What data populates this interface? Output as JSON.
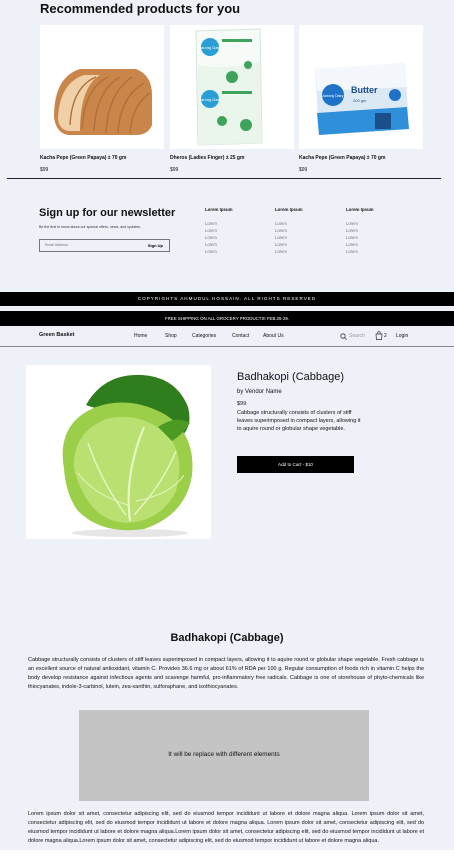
{
  "recommended": {
    "title": "Recommended products for you",
    "products": [
      {
        "name": "Kacha Pepe (Green Papaya) ± 70 gm",
        "price": "$99"
      },
      {
        "name": "Dheros (Ladies Finger) ± 25 gm",
        "price": "$99"
      },
      {
        "name": "Kacha Pepe (Green Papaya) ± 70 gm",
        "price": "$99"
      }
    ]
  },
  "newsletter": {
    "title": "Sign up for our newsletter",
    "subtitle": "Be the first to know about our special offers, news, and updates.",
    "email_placeholder": "Email Address",
    "submit_label": "Sign Up"
  },
  "footer_columns": [
    {
      "heading": "Lorem Ipsum",
      "links": [
        "Lorem",
        "Lorem",
        "Lorem",
        "Lorem",
        "Lorem"
      ]
    },
    {
      "heading": "Lorem Ipsum",
      "links": [
        "Lorem",
        "Lorem",
        "Lorem",
        "Lorem",
        "Lorem"
      ]
    },
    {
      "heading": "Lorem Ipsum",
      "links": [
        "Lorem",
        "Lorem",
        "Lorem",
        "Lorem",
        "Lorem"
      ]
    }
  ],
  "copyright": "COPYRIGHTS AHMUDUL HOSSAIN. ALL RIGHTS RESERVED",
  "shipping_banner": "FREE SHIPPING ON ALL GROCERY PRODUCTS! FEB.25-29.",
  "nav": {
    "brand": "Green Basket",
    "links": [
      "Home",
      "Shop",
      "Categories",
      "Contact",
      "About Us"
    ],
    "search_placeholder": "Search",
    "cart_count": "2",
    "login": "Login"
  },
  "product": {
    "title": "Badhakopi (Cabbage)",
    "vendor": "by Vendor Name",
    "price": "$99",
    "short_description": "Cabbage structurally consists of clusters of stiff leaves superimposed in compact layers, allowing it to aquire round or globular shape vegetable.",
    "add_to_cart": "Add to Cart - $10"
  },
  "details": {
    "title": "Badhakopi (Cabbage)",
    "description": "Cabbage structurally consists of clusters of stiff leaves superimposed in compact layers, allowing it to aquire round or globular shape vegetable. Fresh cabbage is an excellent source of natural antioxidant, vitamin C. Provides 36.6 mg or about 61% of RDA per 100 g. Regular consumption of foods rich in vitamin C helps the body develop resistance against infectious agents and scavenge harmful, pro-inflammatory free radicals. Cabbage is one of storehouse of phyto-chemicals like thiocyanates, indole-3-carbinol, lutein, zea-xanthin, sulforaphane, and isothiocyanates.",
    "placeholder_text": "It will be replace with different elements",
    "lorem": "Lorem ipsum dolor sit amet, consectetur adipiscing elit, sed do eiusmod tempor incididunt ut labore et dolore magna aliqua. Lorem ipsum dolor sit amet, consectetur adipiscing elit, sed do eiusmod tempor incididunt ut labore et dolore magna aliqua. Lorem ipsum dolor sit amet, consectetur adipiscing elit, sed do eiusmod tempor incididunt ut labore et dolore magna aliqua.Lorem ipsum dolor sit amet, consectetur adipiscing elit, sed do eiusmod tempor incididunt ut labore et dolore magna aliqua.Lorem ipsum dolor sit amet, consectetur adipiscing elit, sed do eiusmod tempor incididunt ut labore et dolore magna aliqua."
  },
  "package_text": {
    "milk_brand": "Aarong Dairy",
    "butter_label": "Butter",
    "butter_weight": "200 gm"
  },
  "colors": {
    "background": "#eef1f7",
    "banner": "#000000",
    "button": "#000000",
    "placeholder": "#c4c4c4"
  }
}
